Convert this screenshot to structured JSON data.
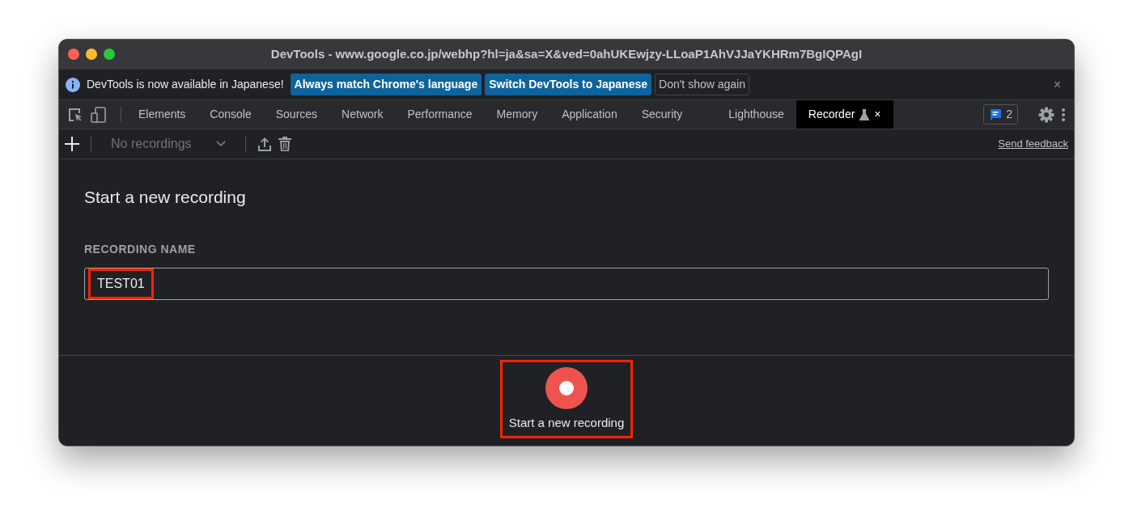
{
  "window": {
    "title": "DevTools - www.google.co.jp/webhp?hl=ja&sa=X&ved=0ahUKEwjzy-LLoaP1AhVJJaYKHRm7BgIQPAgI"
  },
  "infobar": {
    "message": "DevTools is now available in Japanese!",
    "buttons": [
      {
        "label": "Always match Chrome's language",
        "kind": "primary"
      },
      {
        "label": "Switch DevTools to Japanese",
        "kind": "primary"
      },
      {
        "label": "Don't show again",
        "kind": "secondary"
      }
    ],
    "close": "×"
  },
  "tabs": [
    {
      "label": "Elements",
      "selected": false
    },
    {
      "label": "Console",
      "selected": false
    },
    {
      "label": "Sources",
      "selected": false
    },
    {
      "label": "Network",
      "selected": false
    },
    {
      "label": "Performance",
      "selected": false
    },
    {
      "label": "Memory",
      "selected": false
    },
    {
      "label": "Application",
      "selected": false
    },
    {
      "label": "Security",
      "selected": false
    },
    {
      "label": "Lighthouse",
      "selected": false
    },
    {
      "label": "Recorder",
      "selected": true,
      "experimental": true,
      "close": "×"
    }
  ],
  "issues_badge": {
    "count": "2"
  },
  "toolbar": {
    "recordings_select": {
      "value": "No recordings",
      "disabled": true
    },
    "send_feedback": "Send feedback"
  },
  "form": {
    "heading": "Start a new recording",
    "label": "RECORDING NAME",
    "input": {
      "value": "TEST01",
      "highlighted": true
    }
  },
  "record_button": {
    "label": "Start a new recording",
    "highlighted": true
  }
}
